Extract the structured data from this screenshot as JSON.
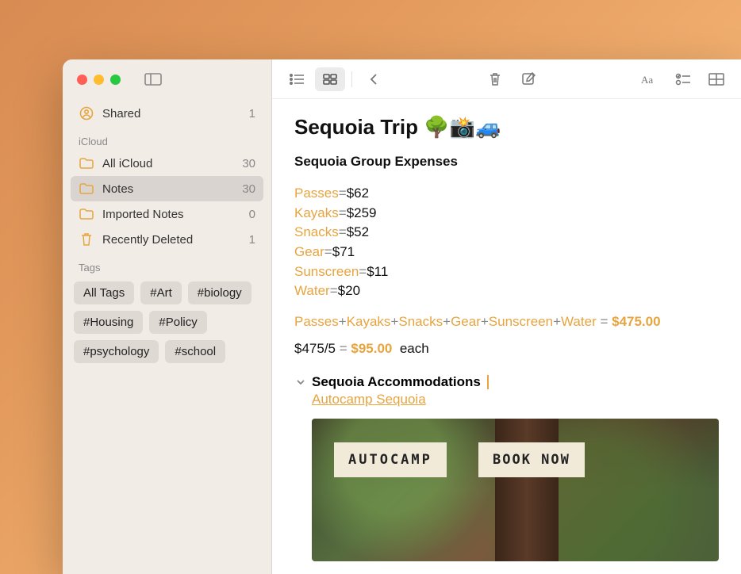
{
  "sidebar": {
    "shared": {
      "label": "Shared",
      "count": "1"
    },
    "section_icloud": "iCloud",
    "folders": [
      {
        "label": "All iCloud",
        "count": "30",
        "icon": "folder",
        "selected": false
      },
      {
        "label": "Notes",
        "count": "30",
        "icon": "folder",
        "selected": true
      },
      {
        "label": "Imported Notes",
        "count": "0",
        "icon": "folder",
        "selected": false
      },
      {
        "label": "Recently Deleted",
        "count": "1",
        "icon": "trash",
        "selected": false
      }
    ],
    "section_tags": "Tags",
    "tags": [
      "All Tags",
      "#Art",
      "#biology",
      "#Housing",
      "#Policy",
      "#psychology",
      "#school"
    ]
  },
  "note": {
    "title": "Sequoia Trip 🌳📸🚙",
    "subtitle": "Sequoia Group Expenses",
    "expenses": [
      {
        "name": "Passes",
        "value": "$62"
      },
      {
        "name": "Kayaks",
        "value": "$259"
      },
      {
        "name": "Snacks",
        "value": "$52"
      },
      {
        "name": "Gear",
        "value": "$71"
      },
      {
        "name": "Sunscreen",
        "value": "$11"
      },
      {
        "name": "Water",
        "value": "$20"
      }
    ],
    "sum_vars": [
      "Passes",
      "Kayaks",
      "Snacks",
      "Gear",
      "Sunscreen",
      "Water"
    ],
    "sum_total": "$475.00",
    "division_lhs": "$475/5",
    "division_result": "$95.00",
    "division_suffix": "each",
    "accommodations_header": "Sequoia Accommodations",
    "accommodations_link": "Autocamp Sequoia",
    "preview_logo": "AUTOCAMP",
    "preview_cta": "BOOK NOW"
  },
  "colors": {
    "accent": "#e7a53f"
  }
}
